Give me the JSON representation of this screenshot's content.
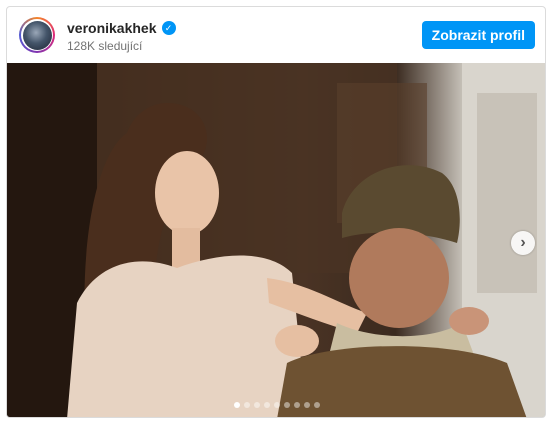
{
  "post": {
    "username": "veronikakhek",
    "followers": "128K sledující",
    "profile_button": "Zobrazit profil",
    "avatar_icon": "profile-avatar",
    "verified_icon": "verified-badge",
    "next_icon": "chevron-right",
    "carousel": {
      "total": 9,
      "active_index": 1
    },
    "image": {
      "description_colors": {
        "background": "#3e2819",
        "dress": "#e7d3c2",
        "hat": "#5a4a30",
        "sweater": "#6e5232",
        "right_wall": "#d8d4cc"
      }
    },
    "accent_color": "#0095f6"
  }
}
